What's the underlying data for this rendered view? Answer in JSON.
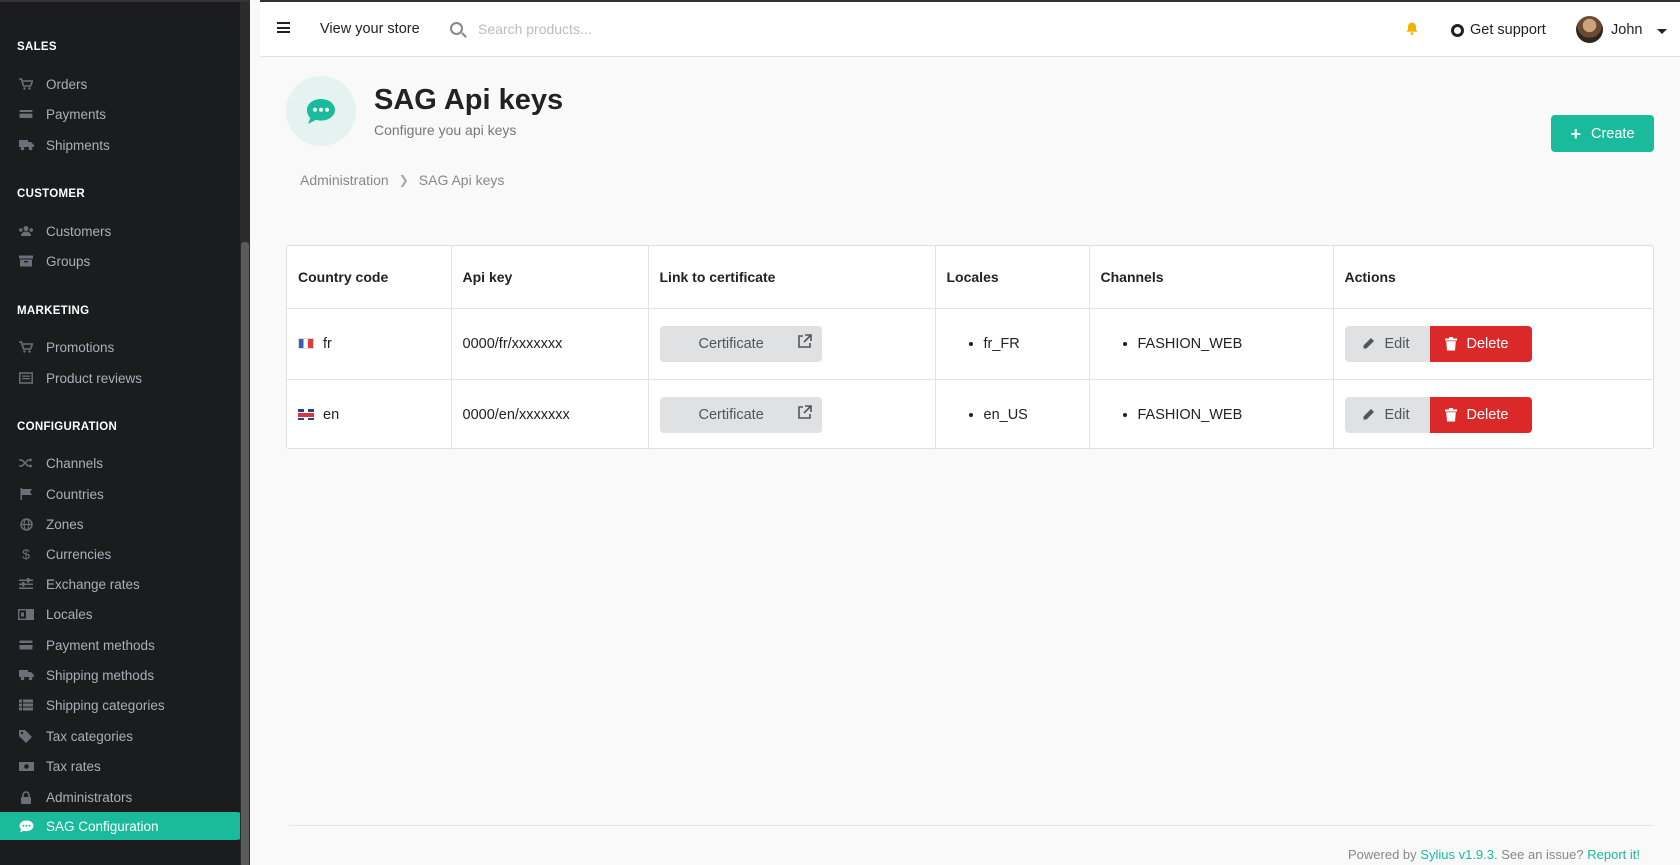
{
  "sidebar": {
    "sections": [
      {
        "title": "SALES",
        "items": [
          {
            "label": "Orders",
            "icon": "cart-icon"
          },
          {
            "label": "Payments",
            "icon": "payment-icon"
          },
          {
            "label": "Shipments",
            "icon": "truck-icon"
          }
        ]
      },
      {
        "title": "CUSTOMER",
        "items": [
          {
            "label": "Customers",
            "icon": "users-icon"
          },
          {
            "label": "Groups",
            "icon": "archive-icon"
          }
        ]
      },
      {
        "title": "MARKETING",
        "items": [
          {
            "label": "Promotions",
            "icon": "cart-icon"
          },
          {
            "label": "Product reviews",
            "icon": "newspaper-icon"
          }
        ]
      },
      {
        "title": "CONFIGURATION",
        "items": [
          {
            "label": "Channels",
            "icon": "random-icon"
          },
          {
            "label": "Countries",
            "icon": "flag-icon"
          },
          {
            "label": "Zones",
            "icon": "globe-icon"
          },
          {
            "label": "Currencies",
            "icon": "dollar-icon"
          },
          {
            "label": "Exchange rates",
            "icon": "sliders-icon"
          },
          {
            "label": "Locales",
            "icon": "language-icon"
          },
          {
            "label": "Payment methods",
            "icon": "credit-card-icon"
          },
          {
            "label": "Shipping methods",
            "icon": "truck-icon"
          },
          {
            "label": "Shipping categories",
            "icon": "list-icon"
          },
          {
            "label": "Tax categories",
            "icon": "tags-icon"
          },
          {
            "label": "Tax rates",
            "icon": "money-icon"
          },
          {
            "label": "Administrators",
            "icon": "lock-icon"
          },
          {
            "label": "SAG Configuration",
            "icon": "comment-dots-icon",
            "active": true
          }
        ]
      }
    ]
  },
  "topbar": {
    "view_store": "View your store",
    "search_placeholder": "Search products...",
    "support": "Get support",
    "user": "John"
  },
  "header": {
    "title": "SAG Api keys",
    "subtitle": "Configure you api keys",
    "create_label": "Create"
  },
  "breadcrumb": {
    "root": "Administration",
    "current": "SAG Api keys"
  },
  "table": {
    "columns": [
      "Country code",
      "Api key",
      "Link to certificate",
      "Locales",
      "Channels",
      "Actions"
    ],
    "rows": [
      {
        "country": "fr",
        "flag": "fr",
        "api_key": "0000/fr/xxxxxxx",
        "certificate": "Certificate",
        "locale": "fr_FR",
        "channel": "FASHION_WEB",
        "edit": "Edit",
        "delete": "Delete"
      },
      {
        "country": "en",
        "flag": "gb",
        "api_key": "0000/en/xxxxxxx",
        "certificate": "Certificate",
        "locale": "en_US",
        "channel": "FASHION_WEB",
        "edit": "Edit",
        "delete": "Delete"
      }
    ]
  },
  "footer": {
    "powered_by": "Powered by",
    "sylius": "Sylius v1.9.3",
    "issue": ". See an issue?",
    "report": "Report it!"
  },
  "colors": {
    "accent": "#1abb9c",
    "danger": "#db2828",
    "sidebar_bg": "#1b1c1d"
  }
}
